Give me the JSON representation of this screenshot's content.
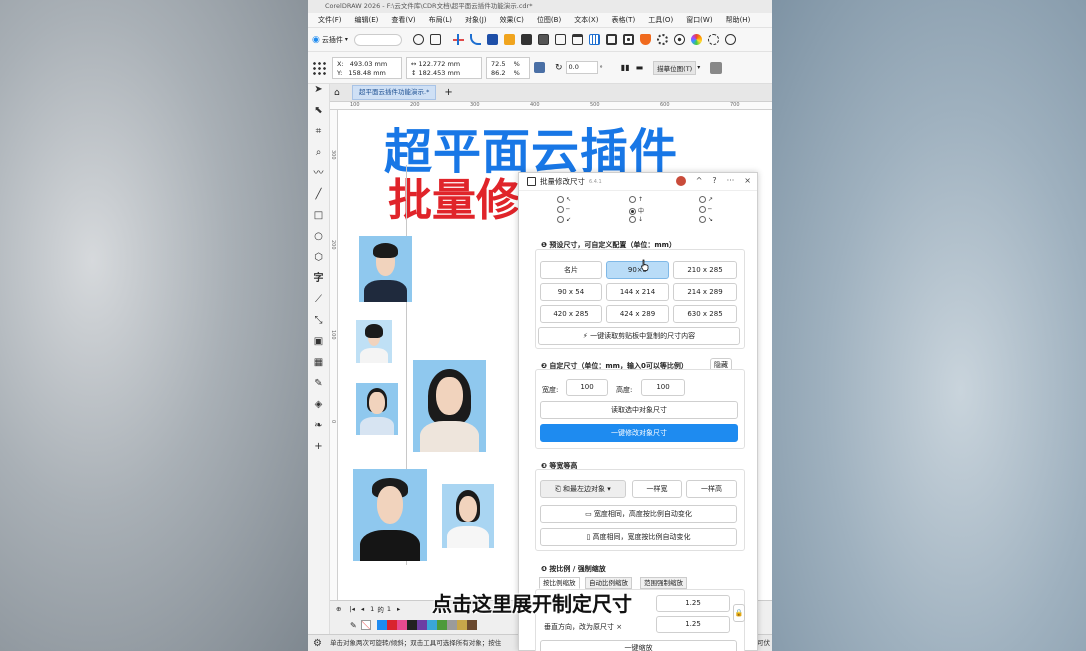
{
  "window": {
    "title": "CorelDRAW 2026 - F:\\云文件库\\CDR文档\\超平面云插件功能演示.cdr*"
  },
  "menu": [
    "文件(F)",
    "编辑(E)",
    "查看(V)",
    "布局(L)",
    "对象(J)",
    "效果(C)",
    "位图(B)",
    "文本(X)",
    "表格(T)",
    "工具(O)",
    "窗口(W)",
    "帮助(H)"
  ],
  "toolbar": {
    "plugin_label": "云插件"
  },
  "properties": {
    "x_label": "X:",
    "x_value": "493.03 mm",
    "y_label": "Y:",
    "y_value": "158.48 mm",
    "width_value": "122.772 mm",
    "height_value": "182.453 mm",
    "scale_x": "72.5",
    "scale_y": "86.2",
    "scale_unit": "%",
    "rotation": "0.0",
    "rotation_unit": "°",
    "outline_position": "描摹位图(T)"
  },
  "doc_tab": "超平面云插件功能演示.*",
  "rulers": {
    "h": [
      "100",
      "200",
      "300",
      "400",
      "500",
      "600",
      "700"
    ],
    "v": [
      "300",
      "200",
      "100",
      "0"
    ]
  },
  "canvas": {
    "headline1": "超平面云插件",
    "headline2": "批量修"
  },
  "dialog": {
    "title": "批量修改尺寸",
    "version": "6.4.1",
    "center_label": "中",
    "section1": {
      "heading": "预设尺寸，可自定义配置（单位：mm）",
      "presets": [
        "名片",
        "90×5",
        "210 x 285",
        "90 x 54",
        "144 x 214",
        "214 x 289",
        "420 x 285",
        "424 x 289",
        "630 x 285"
      ],
      "clipboard_btn": "一键读取剪贴板中复制的尺寸内容"
    },
    "section2": {
      "heading": "自定尺寸（单位：mm，输入0可以等比例）",
      "hide_btn": "隐藏",
      "width_label": "宽度:",
      "width_value": "100",
      "height_label": "高度:",
      "height_value": "100",
      "read_btn": "读取选中对象尺寸",
      "apply_btn": "一键修改对象尺寸"
    },
    "section3": {
      "heading": "等宽等高",
      "dropdown": "和最左边对象",
      "same_width": "一样宽",
      "same_height": "一样高",
      "width_same_btn": "宽度相同，高度按比例自动变化",
      "height_same_btn": "高度相同，宽度按比例自动变化"
    },
    "section4": {
      "heading": "按比例 / 强制缩放",
      "tabs": [
        "按比例缩放",
        "自动比例缩放",
        "范围强制缩放"
      ],
      "h_value": "1.25",
      "v_label": "垂直方向，改为原尺寸 ×",
      "v_value": "1.25",
      "apply_btn": "一键缩放"
    }
  },
  "pager": {
    "page_current": "1",
    "page_sep": "的",
    "page_total": "1"
  },
  "status": "单击对象两次可旋转/倾斜；双击工具可选择所有对象；按住",
  "status_right": "击可伏",
  "caption": "点击这里展开制定尺寸",
  "palette_colors": [
    "#1e8bf0",
    "#d9232e",
    "#e84a8f",
    "#222222",
    "#6c3ea3",
    "#3aa6d8",
    "#4d9a3b",
    "#9b9b9b",
    "#c7a64a",
    "#6b4a2f"
  ]
}
